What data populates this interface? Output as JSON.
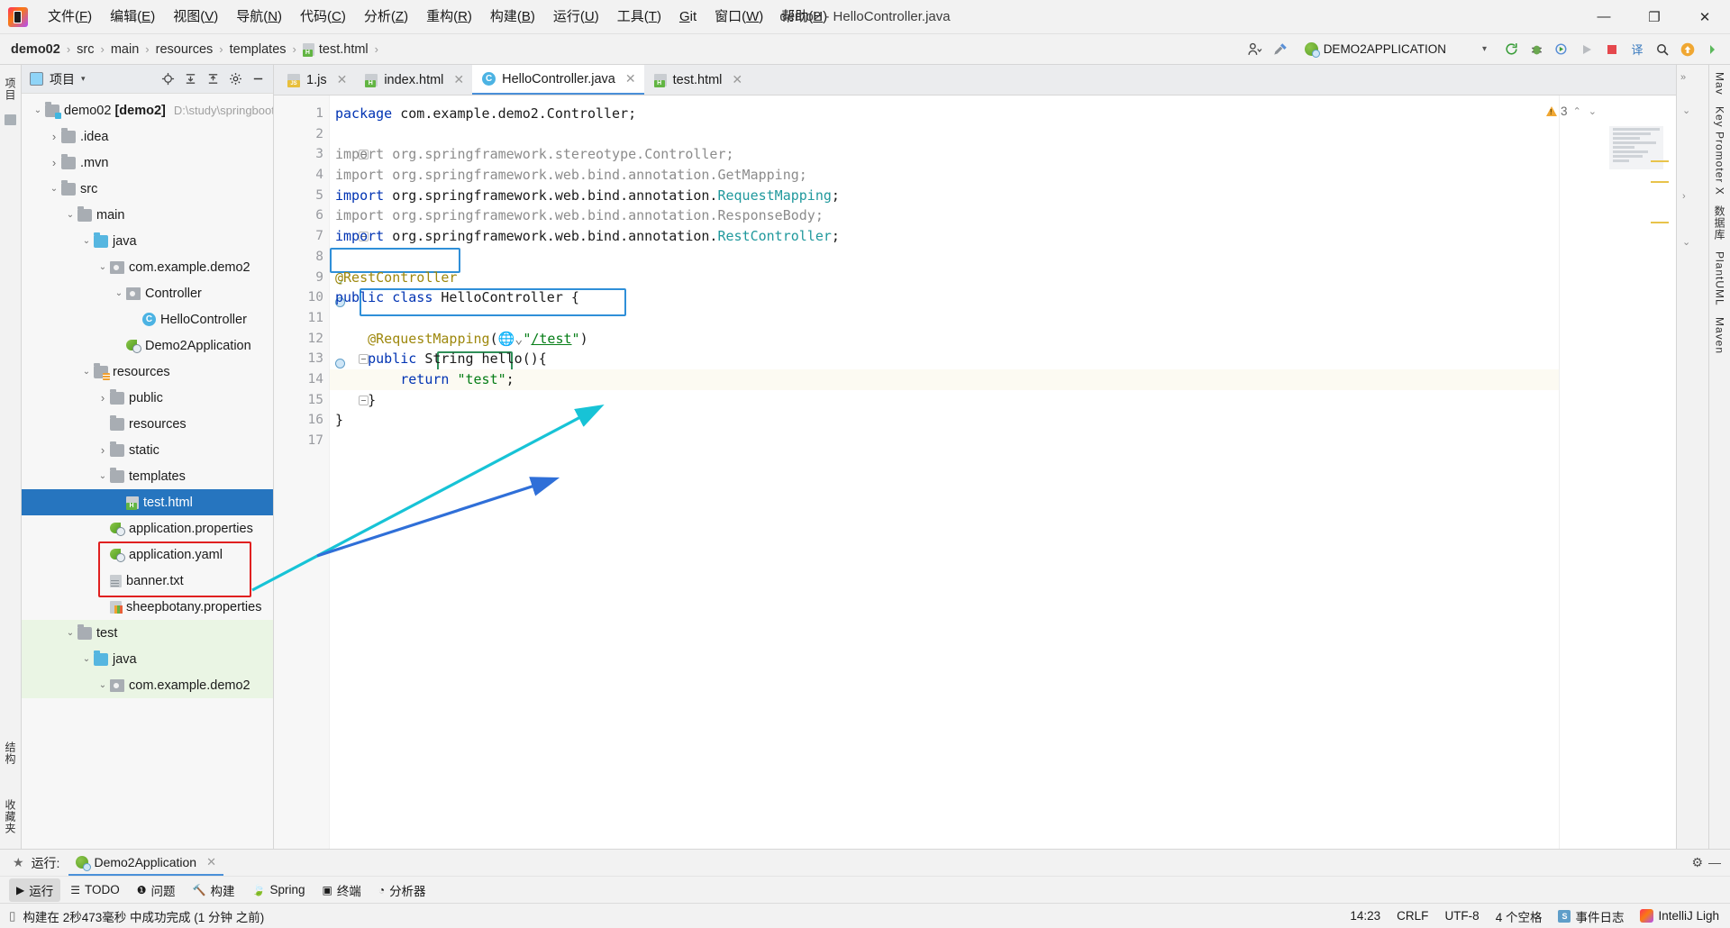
{
  "window": {
    "title": "demo2 - HelloController.java"
  },
  "menubar": {
    "items": [
      {
        "label": "文件(F)",
        "mnemonic": "F"
      },
      {
        "label": "编辑(E)",
        "mnemonic": "E"
      },
      {
        "label": "视图(V)",
        "mnemonic": "V"
      },
      {
        "label": "导航(N)",
        "mnemonic": "N"
      },
      {
        "label": "代码(C)",
        "mnemonic": "C"
      },
      {
        "label": "分析(Z)",
        "mnemonic": "Z"
      },
      {
        "label": "重构(R)",
        "mnemonic": "R"
      },
      {
        "label": "构建(B)",
        "mnemonic": "B"
      },
      {
        "label": "运行(U)",
        "mnemonic": "U"
      },
      {
        "label": "工具(T)",
        "mnemonic": "T"
      },
      {
        "label": "Git",
        "mnemonic": "G"
      },
      {
        "label": "窗口(W)",
        "mnemonic": "W"
      },
      {
        "label": "帮助(H)",
        "mnemonic": "H"
      }
    ],
    "minimize": "—",
    "maximize": "❐",
    "close": "✕"
  },
  "breadcrumb": {
    "items": [
      "demo02",
      "src",
      "main",
      "resources",
      "templates",
      "test.html"
    ],
    "separator": "›"
  },
  "toolbar": {
    "run_config": "DEMO2APPLICATION",
    "run_config_caret": "▾",
    "profile_label": "▾",
    "buttons": [
      {
        "name": "user-settings",
        "glyph": "👤"
      },
      {
        "name": "build-hammer",
        "glyph": "🔨"
      },
      {
        "name": "update-project",
        "glyph": "↻"
      },
      {
        "name": "debug",
        "glyph": "🐞"
      },
      {
        "name": "run-with-coverage",
        "glyph": "▣"
      },
      {
        "name": "run",
        "glyph": "▶"
      },
      {
        "name": "stop",
        "glyph": "■"
      },
      {
        "name": "translate",
        "glyph": "译"
      },
      {
        "name": "search-everywhere",
        "glyph": "🔍"
      },
      {
        "name": "notifications",
        "glyph": "↑"
      },
      {
        "name": "ide-right",
        "glyph": "▶"
      }
    ]
  },
  "project_panel": {
    "title": "项目",
    "caret": "▾",
    "tools": [
      "⊕",
      "⇟",
      "⇞",
      "⚙",
      "—"
    ],
    "tree": [
      {
        "depth": 0,
        "arrow": "v",
        "icon": "folder-src",
        "label": "demo02 [demo2]",
        "bold_part": "[demo2]",
        "sub": "D:\\study\\springboot\\",
        "state": "normal"
      },
      {
        "depth": 1,
        "arrow": ">",
        "icon": "folder",
        "label": ".idea",
        "state": "normal"
      },
      {
        "depth": 1,
        "arrow": ">",
        "icon": "folder",
        "label": ".mvn",
        "state": "normal"
      },
      {
        "depth": 1,
        "arrow": "v",
        "icon": "folder",
        "label": "src",
        "state": "normal"
      },
      {
        "depth": 2,
        "arrow": "v",
        "icon": "folder",
        "label": "main",
        "state": "normal"
      },
      {
        "depth": 3,
        "arrow": "v",
        "icon": "folder-java",
        "label": "java",
        "state": "normal"
      },
      {
        "depth": 4,
        "arrow": "v",
        "icon": "package",
        "label": "com.example.demo2",
        "state": "normal"
      },
      {
        "depth": 5,
        "arrow": "v",
        "icon": "package",
        "label": "Controller",
        "state": "normal"
      },
      {
        "depth": 6,
        "arrow": "",
        "icon": "class",
        "label": "HelloController",
        "state": "normal"
      },
      {
        "depth": 5,
        "arrow": "",
        "icon": "spring-class",
        "label": "Demo2Application",
        "state": "normal"
      },
      {
        "depth": 3,
        "arrow": "v",
        "icon": "folder-res",
        "label": "resources",
        "state": "normal"
      },
      {
        "depth": 4,
        "arrow": ">",
        "icon": "folder",
        "label": "public",
        "state": "normal"
      },
      {
        "depth": 4,
        "arrow": "",
        "icon": "folder",
        "label": "resources",
        "state": "normal"
      },
      {
        "depth": 4,
        "arrow": ">",
        "icon": "folder",
        "label": "static",
        "state": "normal"
      },
      {
        "depth": 4,
        "arrow": "v",
        "icon": "folder",
        "label": "templates",
        "state": "normal"
      },
      {
        "depth": 5,
        "arrow": "",
        "icon": "html",
        "label": "test.html",
        "state": "selected"
      },
      {
        "depth": 4,
        "arrow": "",
        "icon": "spring-file",
        "label": "application.properties",
        "state": "normal"
      },
      {
        "depth": 4,
        "arrow": "",
        "icon": "spring-file",
        "label": "application.yaml",
        "state": "normal"
      },
      {
        "depth": 4,
        "arrow": "",
        "icon": "txt",
        "label": "banner.txt",
        "state": "normal"
      },
      {
        "depth": 4,
        "arrow": "",
        "icon": "props",
        "label": "sheepbotany.properties",
        "state": "normal"
      },
      {
        "depth": 2,
        "arrow": "v",
        "icon": "folder",
        "label": "test",
        "state": "green"
      },
      {
        "depth": 3,
        "arrow": "v",
        "icon": "folder-java",
        "label": "java",
        "state": "green"
      },
      {
        "depth": 4,
        "arrow": "v",
        "icon": "package",
        "label": "com.example.demo2",
        "state": "green"
      }
    ]
  },
  "left_strip": {
    "tabs": [
      "项目",
      "结构",
      "收藏夹"
    ]
  },
  "right_strip": {
    "tabs": [
      "Maven",
      "Key Promoter X",
      "数据库",
      "PlantUML",
      "m Maven"
    ],
    "labels": [
      "Mav",
      "Key Promoter X",
      "数据库",
      "PlantUML",
      "Maven"
    ]
  },
  "editor": {
    "tabs": [
      {
        "label": "1.js",
        "icon": "js",
        "active": false,
        "close": "✕"
      },
      {
        "label": "index.html",
        "icon": "html",
        "active": false,
        "close": "✕"
      },
      {
        "label": "HelloController.java",
        "icon": "class",
        "active": true,
        "close": "✕"
      },
      {
        "label": "test.html",
        "icon": "html",
        "active": false,
        "close": "✕"
      }
    ],
    "warning_count": "3",
    "code_lines": [
      {
        "n": 1,
        "text": "package com.example.demo2.Controller;"
      },
      {
        "n": 2,
        "text": ""
      },
      {
        "n": 3,
        "text": "import org.springframework.stereotype.Controller;"
      },
      {
        "n": 4,
        "text": "import org.springframework.web.bind.annotation.GetMapping;"
      },
      {
        "n": 5,
        "text": "import org.springframework.web.bind.annotation.RequestMapping;"
      },
      {
        "n": 6,
        "text": "import org.springframework.web.bind.annotation.ResponseBody;"
      },
      {
        "n": 7,
        "text": "import org.springframework.web.bind.annotation.RestController;"
      },
      {
        "n": 8,
        "text": ""
      },
      {
        "n": 9,
        "text": "@RestController"
      },
      {
        "n": 10,
        "text": "public class HelloController {"
      },
      {
        "n": 11,
        "text": ""
      },
      {
        "n": 12,
        "text": "    @RequestMapping(\"/test\")"
      },
      {
        "n": 13,
        "text": "    public String hello(){"
      },
      {
        "n": 14,
        "text": "        return \"test\";"
      },
      {
        "n": 15,
        "text": "    }"
      },
      {
        "n": 16,
        "text": "}"
      },
      {
        "n": 17,
        "text": ""
      }
    ],
    "line_numbers": [
      "1",
      "2",
      "3",
      "4",
      "5",
      "6",
      "7",
      "8",
      "9",
      "10",
      "11",
      "12",
      "13",
      "14",
      "15",
      "16",
      "17"
    ]
  },
  "run_panel": {
    "label": "运行:",
    "tab": "Demo2Application",
    "tab_close": "✕",
    "settings_glyph": "⚙",
    "minimize_glyph": "—"
  },
  "bottom_tools": [
    {
      "label": "运行",
      "icon": "run-icon",
      "active": true
    },
    {
      "label": "TODO",
      "icon": "todo-icon",
      "active": false
    },
    {
      "label": "问题",
      "icon": "problems-icon",
      "active": false
    },
    {
      "label": "构建",
      "icon": "build-icon",
      "active": false
    },
    {
      "label": "Spring",
      "icon": "spring-icon",
      "active": false
    },
    {
      "label": "终端",
      "icon": "terminal-icon",
      "active": false
    },
    {
      "label": "分析器",
      "icon": "profiler-icon",
      "active": false
    }
  ],
  "statusbar": {
    "message": "构建在 2秒473毫秒 中成功完成 (1 分钟 之前)",
    "time": "14:23",
    "line_sep": "CRLF",
    "encoding": "UTF-8",
    "indent": "4 个空格",
    "event_log": "事件日志",
    "ide_name": "IntelliJ Ligh"
  },
  "colors": {
    "selection_blue": "#2675bf",
    "highlight_blue": "#2f8fd8",
    "highlight_green": "#2f8f58",
    "highlight_red": "#e02020",
    "arrow_cyan": "#17c3d6",
    "arrow_blue": "#2f6fd8",
    "accent": "#4a90d9"
  }
}
